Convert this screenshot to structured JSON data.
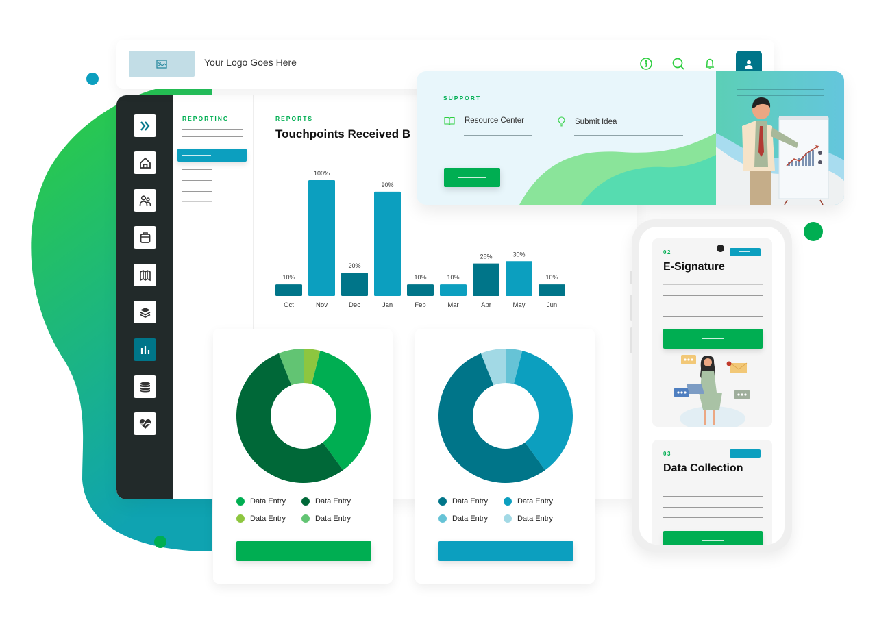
{
  "colors": {
    "brand_green": "#00ae52",
    "teal_dark": "#007589",
    "teal_light": "#0c9fbf",
    "rail_bg": "#222a2a",
    "support_bg": "#e8f6fb",
    "logo_placeholder": "#c2dde6"
  },
  "header": {
    "logo_icon": "image-icon",
    "logo_text": "Your Logo Goes Here",
    "icons": [
      "info-icon",
      "search-icon",
      "bell-icon",
      "user-icon"
    ]
  },
  "sidebar": {
    "items": [
      {
        "icon": "chevrons-right-icon",
        "active": false
      },
      {
        "icon": "home-icon",
        "active": false
      },
      {
        "icon": "users-icon",
        "active": false
      },
      {
        "icon": "clipboard-icon",
        "active": false
      },
      {
        "icon": "map-icon",
        "active": false
      },
      {
        "icon": "layers-icon",
        "active": false
      },
      {
        "icon": "bar-chart-icon",
        "active": true
      },
      {
        "icon": "database-icon",
        "active": false
      },
      {
        "icon": "heart-pulse-icon",
        "active": false
      }
    ]
  },
  "subnav": {
    "title": "REPORTING"
  },
  "main": {
    "section_label": "REPORTS",
    "title": "Touchpoints Received B"
  },
  "support": {
    "label": "SUPPORT",
    "links": [
      {
        "icon": "book-icon",
        "label": "Resource Center"
      },
      {
        "icon": "lightbulb-icon",
        "label": "Submit Idea"
      }
    ]
  },
  "phone": {
    "cards": [
      {
        "number": "02",
        "title": "E-Signature"
      },
      {
        "number": "03",
        "title": "Data Collection"
      }
    ]
  },
  "chart_data": [
    {
      "type": "bar",
      "title": "Touchpoints Received B",
      "categories": [
        "Oct",
        "Nov",
        "Dec",
        "Jan",
        "Feb",
        "Mar",
        "Apr",
        "May",
        "Jun"
      ],
      "values": [
        10,
        100,
        20,
        90,
        10,
        10,
        28,
        30,
        10
      ],
      "data_labels": [
        "10%",
        "100%",
        "20%",
        "90%",
        "10%",
        "10%",
        "28%",
        "30%",
        "10%"
      ],
      "bar_colors": [
        "#007589",
        "#0c9fbf",
        "#007589",
        "#0c9fbf",
        "#007589",
        "#0c9fbf",
        "#007589",
        "#0c9fbf",
        "#007589"
      ],
      "ylim": [
        0,
        100
      ],
      "grid": false,
      "xlabel": "",
      "ylabel": ""
    },
    {
      "type": "pie",
      "donut": true,
      "slices": [
        {
          "label": "Data Entry",
          "value": 4,
          "color": "#8dc63f"
        },
        {
          "label": "Data Entry",
          "value": 36,
          "color": "#00ae52"
        },
        {
          "label": "Data Entry",
          "value": 54,
          "color": "#006838"
        },
        {
          "label": "Data Entry",
          "value": 6,
          "color": "#62c473"
        }
      ],
      "legend": [
        {
          "label": "Data Entry",
          "color": "#00ae52"
        },
        {
          "label": "Data Entry",
          "color": "#006838"
        },
        {
          "label": "Data Entry",
          "color": "#8dc63f"
        },
        {
          "label": "Data Entry",
          "color": "#62c473"
        }
      ],
      "legend_position": "bottom"
    },
    {
      "type": "pie",
      "donut": true,
      "slices": [
        {
          "label": "Data Entry",
          "value": 4,
          "color": "#66c3d6"
        },
        {
          "label": "Data Entry",
          "value": 36,
          "color": "#0c9fbf"
        },
        {
          "label": "Data Entry",
          "value": 54,
          "color": "#007589"
        },
        {
          "label": "Data Entry",
          "value": 6,
          "color": "#a2d9e5"
        }
      ],
      "legend": [
        {
          "label": "Data Entry",
          "color": "#007589"
        },
        {
          "label": "Data Entry",
          "color": "#0c9fbf"
        },
        {
          "label": "Data Entry",
          "color": "#66c3d6"
        },
        {
          "label": "Data Entry",
          "color": "#a2d9e5"
        }
      ],
      "legend_position": "bottom"
    }
  ]
}
